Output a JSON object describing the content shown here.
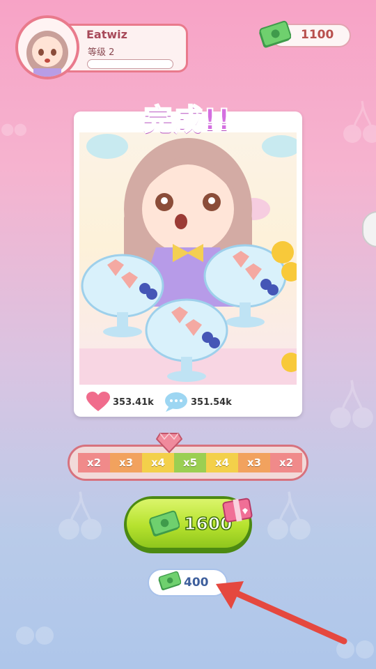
{
  "player": {
    "name": "Eatwiz",
    "level_label": "等级 2",
    "xp_progress": 0.0
  },
  "currency": {
    "balance": "1100",
    "icon": "cash-icon"
  },
  "result": {
    "title": "完成!!",
    "likes": "353.41k",
    "comments": "351.54k"
  },
  "multipliers": [
    "x2",
    "x3",
    "x4",
    "x5",
    "x4",
    "x3",
    "x2"
  ],
  "multiplier_colors": [
    "#f08a8a",
    "#f2a25e",
    "#f3d04a",
    "#9bcf52",
    "#f3d04a",
    "#f2a25e",
    "#f08a8a"
  ],
  "reward_button": {
    "value": "1600",
    "icon": "cash-icon",
    "badge": "gift-icon"
  },
  "claim_button": {
    "value": "400",
    "icon": "cash-icon"
  },
  "colors": {
    "accent_pink": "#e97a8c",
    "button_green": "#b6e22e",
    "title_purple": "#d46fe0"
  }
}
